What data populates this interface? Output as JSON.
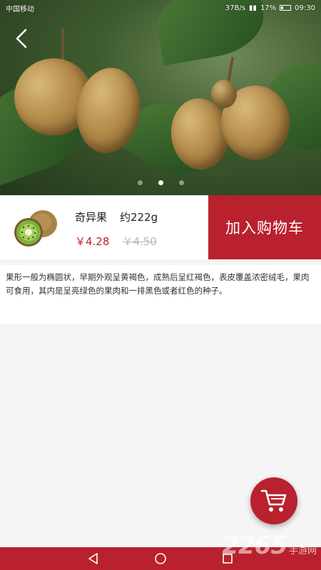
{
  "status_bar": {
    "carrier": "中国移动",
    "speed": "37B/s",
    "battery": "17%",
    "time": "09:30"
  },
  "product": {
    "name": "奇异果",
    "weight": "约222g",
    "price": "￥4.28",
    "original_price": "￥4.50",
    "add_to_cart_label": "加入购物车",
    "description": "果形一般为椭圆状，早期外观呈黄褐色，成熟后呈红褐色，表皮覆盖浓密绒毛，果肉可食用，其内是呈亮绿色的果肉和一排黑色或者红色的种子。"
  },
  "carousel": {
    "dot_count": 3,
    "active_index": 1
  },
  "watermark": {
    "number": "2265",
    "text": "手游网"
  },
  "colors": {
    "accent": "#b8212d",
    "price": "#c41f2c"
  },
  "icons": [
    "back-arrow-icon",
    "cart-icon",
    "nav-back-icon",
    "nav-home-icon",
    "nav-recent-icon"
  ]
}
